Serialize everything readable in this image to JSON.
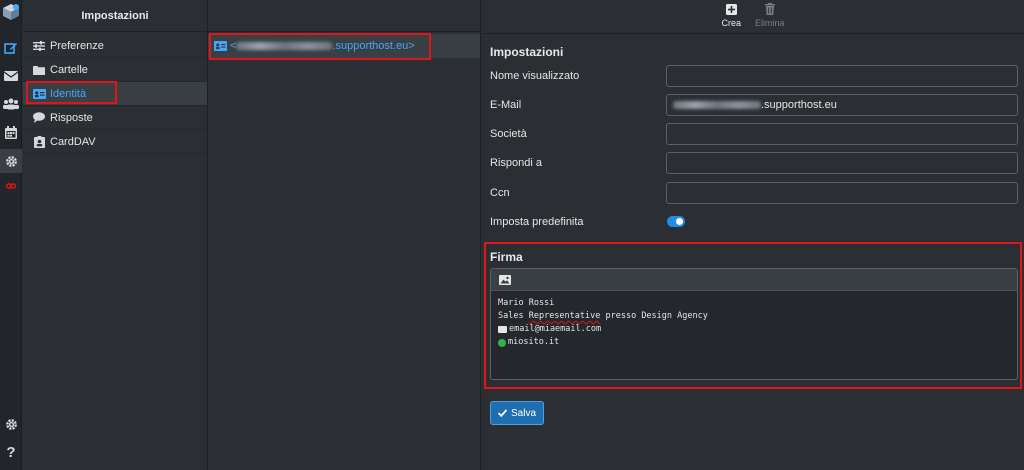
{
  "settings": {
    "title": "Impostazioni",
    "menu": [
      {
        "label": "Preferenze",
        "icon": "sliders-icon"
      },
      {
        "label": "Cartelle",
        "icon": "folder-icon"
      },
      {
        "label": "Identità",
        "icon": "id-card-icon",
        "active": true
      },
      {
        "label": "Risposte",
        "icon": "comment-icon"
      },
      {
        "label": "CardDAV",
        "icon": "contact-card-icon"
      }
    ]
  },
  "identities": {
    "items": [
      {
        "prefix": "<",
        "suffix": ".supporthost.eu>"
      }
    ]
  },
  "toolbar": {
    "create_label": "Crea",
    "delete_label": "Elimina"
  },
  "form": {
    "section_title": "Impostazioni",
    "display_name_label": "Nome visualizzato",
    "display_name_value": "",
    "email_label": "E-Mail",
    "email_value_suffix": ".supporthost.eu",
    "company_label": "Società",
    "company_value": "",
    "reply_to_label": "Rispondi a",
    "reply_to_value": "",
    "bcc_label": "Ccn",
    "bcc_value": "",
    "default_label": "Imposta predefinita",
    "default_enabled": true
  },
  "signature": {
    "title": "Firma",
    "line1": "Mario Rossi",
    "line2_a": "Sales ",
    "line2_b": "Representative",
    "line2_c": " presso Design Agency",
    "email": "email@miaemail.com",
    "website": "miosito.it"
  },
  "save_label": "Salva",
  "colors": {
    "accent": "#3fa9ff",
    "highlight": "#e0141b",
    "save_button": "#1f6fb0"
  }
}
